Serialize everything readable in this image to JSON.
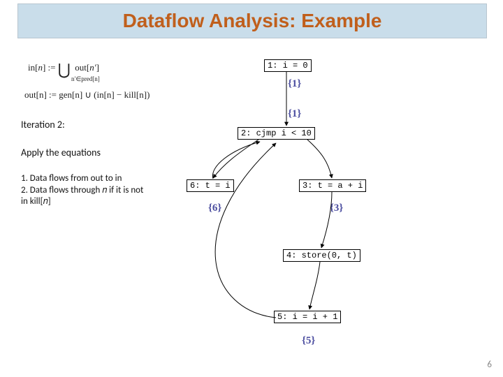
{
  "title": "Dataflow Analysis: Example",
  "equations": {
    "in": "in[n] :=  ⋃  out[n′]",
    "in_sub": "n′∈pred[n]",
    "out": "out[n] := gen[n] ∪ (in[n] − kill[n])"
  },
  "sidebar": {
    "iteration": "Iteration 2:",
    "apply": "Apply the equations",
    "rule1": "1. Data flows from out to in",
    "rule2a": "2. Data flows through 𝑛 if it is not",
    "rule2b": "in kill[𝑛]"
  },
  "nodes": {
    "n1": "1: i = 0",
    "n2": "2: cjmp i < 10",
    "n3": "3: t = a + i",
    "n4": "4: store(0, t)",
    "n5": "5: i = i + 1",
    "n6": "6: t = i"
  },
  "sets": {
    "s1_out": "{1}",
    "s2_in": "{1}",
    "s6_out": "{6}",
    "s3_out": "{3}",
    "s5_out": "{5}"
  },
  "pagenum": "6"
}
